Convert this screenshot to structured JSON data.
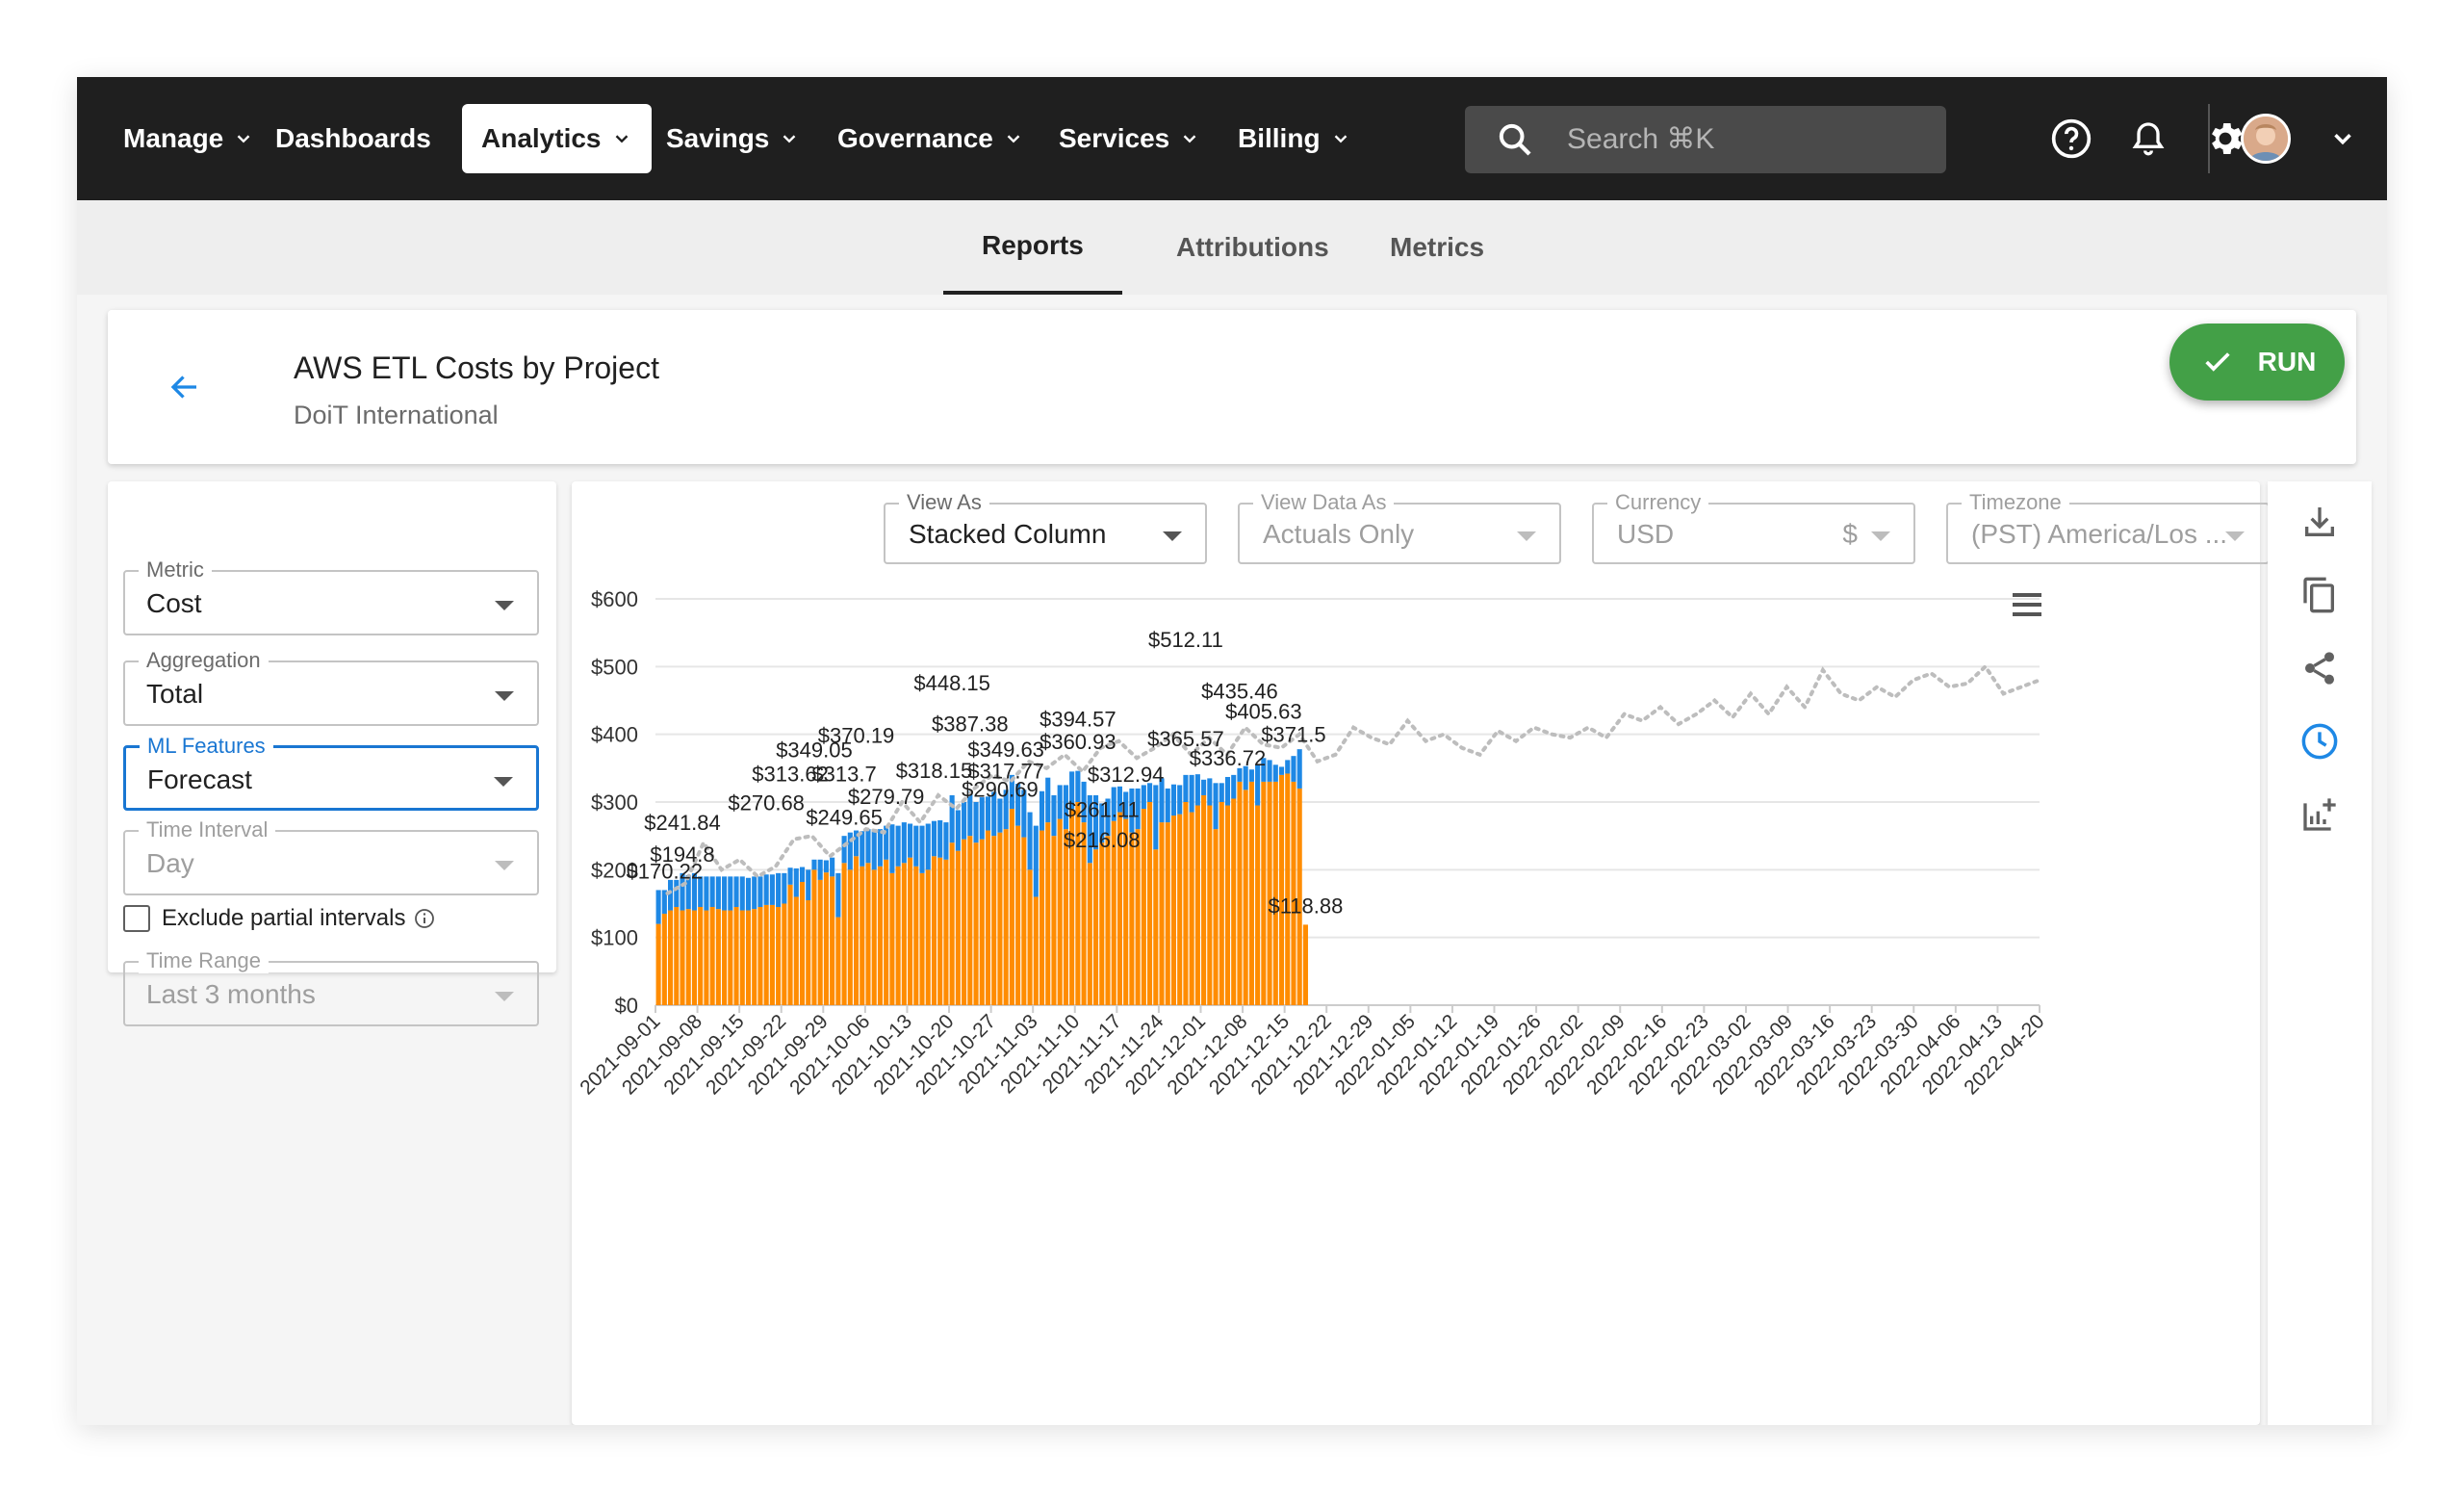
{
  "nav": {
    "items": [
      {
        "label": "Manage",
        "has_dropdown": true
      },
      {
        "label": "Dashboards",
        "has_dropdown": false
      },
      {
        "label": "Analytics",
        "has_dropdown": true,
        "active": true
      },
      {
        "label": "Savings",
        "has_dropdown": true
      },
      {
        "label": "Governance",
        "has_dropdown": true
      },
      {
        "label": "Services",
        "has_dropdown": true
      },
      {
        "label": "Billing",
        "has_dropdown": true
      }
    ],
    "search_placeholder": "Search ⌘K",
    "icons": [
      "help-icon",
      "bell-icon",
      "gear-icon",
      "avatar",
      "chevron-down-icon"
    ]
  },
  "subnav": {
    "tabs": [
      {
        "label": "Reports",
        "active": true
      },
      {
        "label": "Attributions"
      },
      {
        "label": "Metrics"
      }
    ]
  },
  "header": {
    "title": "AWS ETL Costs by Project",
    "subtitle": "DoiT International",
    "run_label": "RUN"
  },
  "sidebar": {
    "metric": {
      "label": "Metric",
      "value": "Cost"
    },
    "aggregation": {
      "label": "Aggregation",
      "value": "Total"
    },
    "ml_features": {
      "label": "ML Features",
      "value": "Forecast"
    },
    "time_interval": {
      "label": "Time Interval",
      "value": "Day"
    },
    "exclude_partial": {
      "label": "Exclude partial intervals",
      "checked": false
    },
    "time_range": {
      "label": "Time Range",
      "value": "Last 3 months"
    }
  },
  "chart_controls": {
    "view_as": {
      "label": "View As",
      "value": "Stacked Column"
    },
    "view_data_as": {
      "label": "View Data As",
      "value": "Actuals Only"
    },
    "currency": {
      "label": "Currency",
      "value": "USD",
      "symbol": "$"
    },
    "timezone": {
      "label": "Timezone",
      "value": "(PST) America/Los ..."
    }
  },
  "colors": {
    "orange": "#ff8c00",
    "blue": "#1e88e5",
    "forecast": "#bdbdbd",
    "run_green": "#43a047",
    "accent_blue": "#1976d2"
  },
  "chart_data": {
    "type": "bar",
    "stacked": true,
    "ylim": [
      0,
      600
    ],
    "yticks": [
      "$0",
      "$100",
      "$200",
      "$300",
      "$400",
      "$500",
      "$600"
    ],
    "xticks": [
      "2021-09-01",
      "2021-09-08",
      "2021-09-15",
      "2021-09-22",
      "2021-09-29",
      "2021-10-06",
      "2021-10-13",
      "2021-10-20",
      "2021-10-27",
      "2021-11-03",
      "2021-11-10",
      "2021-11-17",
      "2021-11-24",
      "2021-12-01",
      "2021-12-08",
      "2021-12-15",
      "2021-12-22",
      "2021-12-29",
      "2022-01-05",
      "2022-01-12",
      "2022-01-19",
      "2022-01-26",
      "2022-02-02",
      "2022-02-09",
      "2022-02-16",
      "2022-02-23",
      "2022-03-02",
      "2022-03-09",
      "2022-03-16",
      "2022-03-23",
      "2022-03-30",
      "2022-04-06",
      "2022-04-13",
      "2022-04-20"
    ],
    "start_date": "2021-09-01",
    "series": [
      {
        "name": "",
        "color": "#ff8c00",
        "values": [
          120,
          135,
          140,
          145,
          140,
          142,
          140,
          145,
          140,
          145,
          142,
          140,
          140,
          145,
          140,
          140,
          142,
          145,
          148,
          148,
          145,
          150,
          178,
          160,
          182,
          155,
          200,
          185,
          196,
          190,
          130,
          210,
          200,
          220,
          205,
          210,
          200,
          205,
          215,
          195,
          205,
          210,
          218,
          205,
          195,
          200,
          220,
          218,
          215,
          240,
          228,
          245,
          250,
          240,
          245,
          258,
          250,
          255,
          260,
          290,
          265,
          248,
          200,
          160,
          258,
          270,
          250,
          275,
          260,
          290,
          300,
          270,
          210,
          230,
          240,
          250,
          272,
          285,
          275,
          255,
          260,
          290,
          300,
          230,
          270,
          270,
          280,
          282,
          300,
          285,
          295,
          310,
          295,
          260,
          300,
          295,
          305,
          330,
          318,
          330,
          295,
          330,
          330,
          330,
          340,
          342,
          330,
          320,
          118.88
        ]
      },
      {
        "name": "",
        "color": "#1e88e5",
        "values": [
          50,
          35,
          45,
          40,
          55,
          50,
          55,
          45,
          50,
          45,
          48,
          50,
          50,
          45,
          50,
          48,
          48,
          45,
          45,
          45,
          50,
          45,
          25,
          42,
          22,
          45,
          15,
          30,
          18,
          28,
          65,
          40,
          55,
          38,
          52,
          50,
          60,
          55,
          50,
          72,
          60,
          60,
          50,
          60,
          70,
          68,
          52,
          55,
          55,
          70,
          60,
          55,
          66,
          60,
          62,
          50,
          65,
          50,
          58,
          50,
          62,
          70,
          85,
          105,
          58,
          66,
          60,
          50,
          65,
          55,
          46,
          60,
          100,
          80,
          58,
          55,
          50,
          38,
          40,
          65,
          60,
          35,
          28,
          95,
          65,
          50,
          46,
          43,
          40,
          55,
          46,
          23,
          40,
          68,
          28,
          42,
          35,
          20,
          35,
          18,
          60,
          35,
          32,
          25,
          12,
          20,
          38,
          58,
          0
        ]
      },
      {
        "name": "",
        "color": "#bdbdbd",
        "forecast": true,
        "note": "dotted forecast line",
        "values": [
          165,
          180,
          240,
          200,
          215,
          190,
          205,
          245,
          250,
          220,
          240,
          260,
          255,
          300,
          270,
          310,
          290,
          320,
          340,
          330,
          360,
          350,
          370,
          345,
          380,
          390,
          365,
          380,
          400,
          370,
          395,
          370,
          410,
          385,
          380,
          400,
          360,
          370,
          410,
          395,
          385,
          420,
          390,
          400,
          380,
          370,
          405,
          390,
          410,
          400,
          395,
          410,
          395,
          430,
          420,
          440,
          415,
          430,
          450,
          425,
          460,
          430,
          470,
          440,
          495,
          460,
          450,
          470,
          455,
          480,
          490,
          470,
          475,
          500,
          460,
          470,
          480
        ]
      }
    ],
    "data_labels": [
      "$170.22",
      "$194.8",
      "$241.84",
      "$270.68",
      "$313.62",
      "$349.05",
      "$313.7",
      "$370.19",
      "$279.79",
      "$249.65",
      "$318.15",
      "$448.15",
      "$387.38",
      "$349.63",
      "$317.77",
      "$290.69",
      "$360.93",
      "$394.57",
      "$312.94",
      "$261.11",
      "$216.08",
      "$365.57",
      "$512.11",
      "$435.46",
      "$336.72",
      "$405.63",
      "$371.5",
      "$118.88"
    ]
  }
}
